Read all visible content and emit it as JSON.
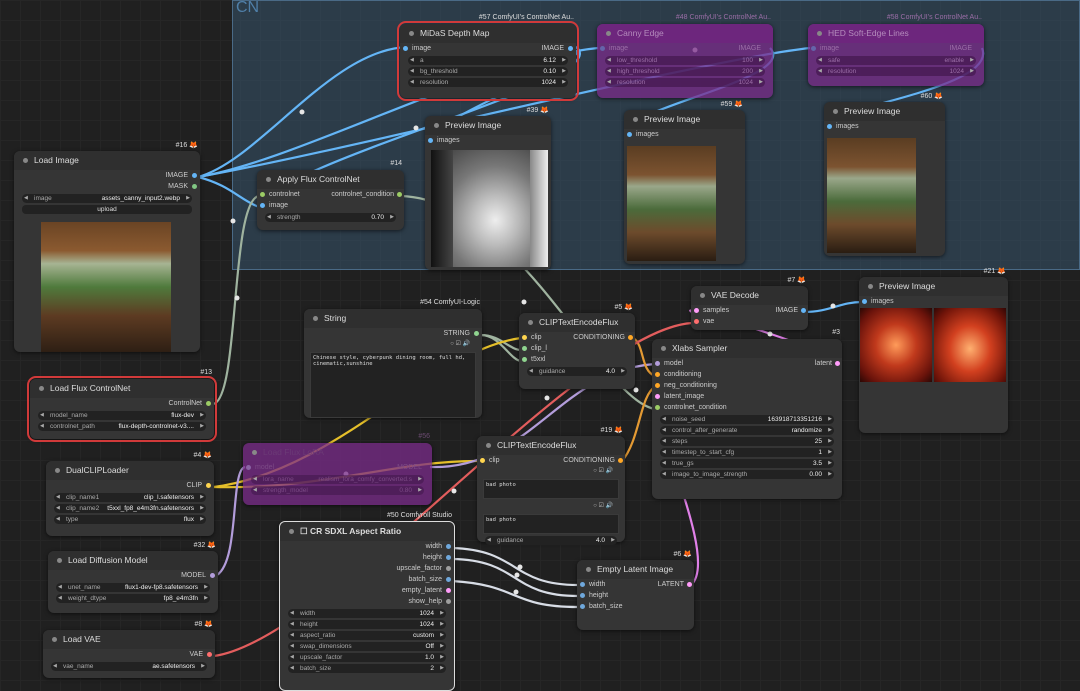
{
  "group": {
    "title": "CN"
  },
  "colors": {
    "image": "#64b5f6",
    "mask": "#81c784",
    "controlnet": "#9ccc65",
    "clip": "#ffd54f",
    "conditioning": "#ffa726",
    "latent": "#ff9cf9",
    "vae": "#ff6e6e",
    "model": "#b39ddb",
    "string": "#8fd48f",
    "highlight": "#d13a3a"
  },
  "nodes": {
    "midas": {
      "badge": "#57 ComfyUI's ControlNet Au..",
      "title": "MiDaS Depth Map",
      "in_image": "image",
      "out_image": "IMAGE",
      "w1": {
        "label": "a",
        "value": "6.12"
      },
      "w2": {
        "label": "bg_threshold",
        "value": "0.10"
      },
      "w3": {
        "label": "resolution",
        "value": "1024"
      }
    },
    "canny": {
      "badge": "#48 ComfyUI's ControlNet Au..",
      "title": "Canny Edge",
      "in_image": "image",
      "out_image": "IMAGE",
      "w1": {
        "label": "low_threshold",
        "value": "100"
      },
      "w2": {
        "label": "high_threshold",
        "value": "200"
      },
      "w3": {
        "label": "resolution",
        "value": "1024"
      }
    },
    "hed": {
      "badge": "#58 ComfyUI's ControlNet Au..",
      "title": "HED Soft-Edge Lines",
      "in_image": "image",
      "out_image": "IMAGE",
      "w1": {
        "label": "safe",
        "value": "enable"
      },
      "w2": {
        "label": "resolution",
        "value": "1024"
      }
    },
    "preview39": {
      "badge": "#39",
      "title": "Preview Image",
      "in_images": "images"
    },
    "preview59": {
      "badge": "#59",
      "title": "Preview Image",
      "in_images": "images"
    },
    "preview60": {
      "badge": "#60",
      "title": "Preview Image",
      "in_images": "images"
    },
    "loadimage": {
      "badge": "#16",
      "title": "Load Image",
      "out_image": "IMAGE",
      "out_mask": "MASK",
      "w1": {
        "label": "image",
        "value": "assets_canny_input2.webp"
      },
      "upload": "upload"
    },
    "applycn": {
      "badge": "#14",
      "title": "Apply Flux ControlNet",
      "in_cn": "controlnet",
      "in_image": "image",
      "out_cond": "controlnet_condition",
      "w1": {
        "label": "strength",
        "value": "0.70"
      }
    },
    "loadcn": {
      "badge": "#13",
      "title": "Load Flux ControlNet",
      "out_cn": "ControlNet",
      "w1": {
        "label": "model_name",
        "value": "flux-dev"
      },
      "w2": {
        "label": "controlnet_path",
        "value": "flux-depth-controlnet-v3...."
      }
    },
    "string": {
      "badge": "#54 ComfyUI-Logic",
      "title": "String",
      "out_str": "STRING",
      "text": "Chinese style, cyberpunk dining room, full hd, cinematic,sunshine"
    },
    "clipflux5": {
      "badge": "#5",
      "title": "CLIPTextEncodeFlux",
      "in_clip": "clip",
      "in_clipl": "clip_l",
      "in_t5": "t5xxl",
      "out_cond": "CONDITIONING",
      "w1": {
        "label": "guidance",
        "value": "4.0"
      }
    },
    "vaedecode": {
      "badge": "#7",
      "title": "VAE Decode",
      "in_samples": "samples",
      "in_vae": "vae",
      "out_image": "IMAGE"
    },
    "preview21": {
      "badge": "#21",
      "title": "Preview Image",
      "in_images": "images"
    },
    "xlabs": {
      "badge": "#3",
      "title": "Xlabs Sampler",
      "in_model": "model",
      "in_cond": "conditioning",
      "in_neg": "neg_conditioning",
      "in_lat": "latent_image",
      "in_cn": "controlnet_condition",
      "out_lat": "latent",
      "w1": {
        "label": "noise_seed",
        "value": "163918713351216"
      },
      "w2": {
        "label": "control_after_generate",
        "value": "randomize"
      },
      "w3": {
        "label": "steps",
        "value": "25"
      },
      "w4": {
        "label": "timestep_to_start_cfg",
        "value": "1"
      },
      "w5": {
        "label": "true_gs",
        "value": "3.5"
      },
      "w6": {
        "label": "image_to_image_strength",
        "value": "0.00"
      }
    },
    "loadfluxlora": {
      "badge": "#56",
      "title": "Load Flux LoRA",
      "in_model": "model",
      "out_model": "MODEL",
      "w1": {
        "label": "lora_name",
        "value": "realism_lora_comfy_converted.s"
      },
      "w2": {
        "label": "strength_model",
        "value": "0.80"
      }
    },
    "clipflux19": {
      "badge": "#19",
      "title": "CLIPTextEncodeFlux",
      "in_clip": "clip",
      "out_cond": "CONDITIONING",
      "text1": "bad photo",
      "text2": "bad photo",
      "w1": {
        "label": "guidance",
        "value": "4.0"
      }
    },
    "dualclip": {
      "badge": "#4",
      "title": "DualCLIPLoader",
      "out_clip": "CLIP",
      "w1": {
        "label": "clip_name1",
        "value": "clip_l.safetensors"
      },
      "w2": {
        "label": "clip_name2",
        "value": "t5xxl_fp8_e4m3fn.safetensors"
      },
      "w3": {
        "label": "type",
        "value": "flux"
      }
    },
    "loaddiff": {
      "badge": "#32",
      "title": "Load Diffusion Model",
      "out_model": "MODEL",
      "w1": {
        "label": "unet_name",
        "value": "flux1-dev-fp8.safetensors"
      },
      "w2": {
        "label": "weight_dtype",
        "value": "fp8_e4m3fn"
      }
    },
    "loadvae": {
      "badge": "#8",
      "title": "Load VAE",
      "out_vae": "VAE",
      "w1": {
        "label": "vae_name",
        "value": "ae.safetensors"
      }
    },
    "sdxl": {
      "badge": "#50 Comfyroll Studio",
      "title": "CR SDXL Aspect Ratio",
      "outs": [
        "width",
        "height",
        "upscale_factor",
        "batch_size",
        "empty_latent",
        "show_help"
      ],
      "w1": {
        "label": "width",
        "value": "1024"
      },
      "w2": {
        "label": "height",
        "value": "1024"
      },
      "w3": {
        "label": "aspect_ratio",
        "value": "custom"
      },
      "w4": {
        "label": "swap_dimensions",
        "value": "Off"
      },
      "w5": {
        "label": "upscale_factor",
        "value": "1.0"
      },
      "w6": {
        "label": "batch_size",
        "value": "2"
      }
    },
    "emptylatent": {
      "badge": "#6",
      "title": "Empty Latent Image",
      "in_w": "width",
      "in_h": "height",
      "in_b": "batch_size",
      "out_lat": "LATENT"
    }
  }
}
